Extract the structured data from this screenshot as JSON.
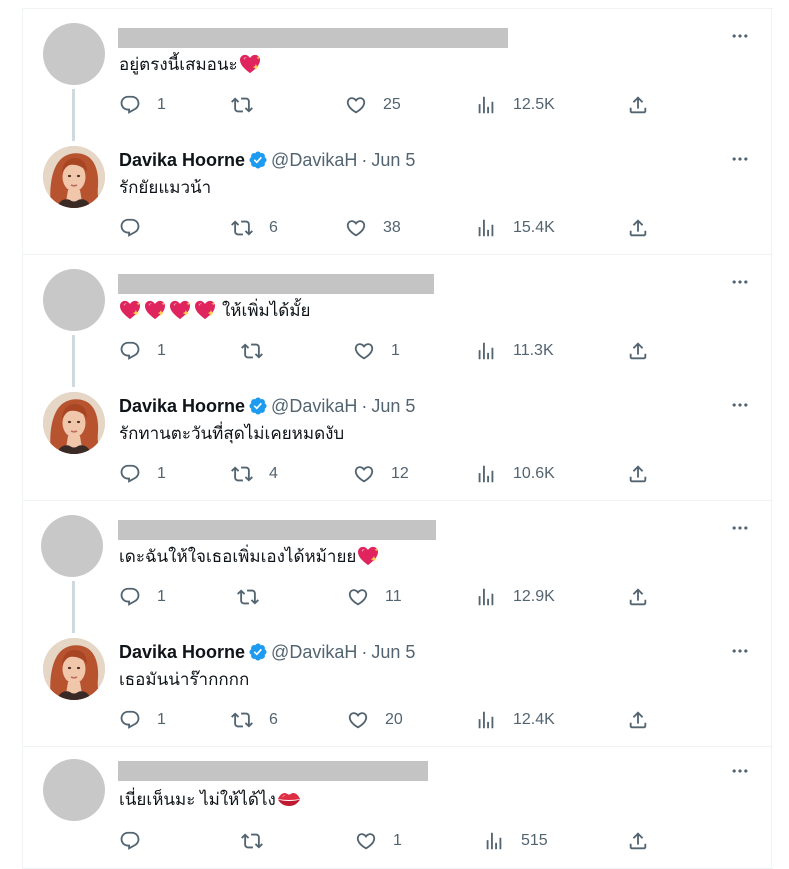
{
  "colors": {
    "accent": "#1d9bf0",
    "icon": "#536471",
    "redaction": "#c4c4c4",
    "heart_emoji": "#e0245e",
    "sparkle": "#ffd34d",
    "kiss": "#dd2e44"
  },
  "groups": [
    {
      "reply": {
        "text": "อยู่ตรงนี้เสมอนะ",
        "emoji": "sparkling-heart-emoji",
        "replies": "1",
        "reposts": "",
        "likes": "25",
        "views": "12.5K"
      },
      "author": {
        "name": "Davika Hoorne",
        "handle": "@DavikaH",
        "separator": "·",
        "date": "Jun 5",
        "text": "รักยัยแมวน้า",
        "replies": "",
        "reposts": "6",
        "likes": "38",
        "views": "15.4K"
      }
    },
    {
      "reply": {
        "text": "ให้เพิ่มได้มั้ย",
        "emoji": "sparkling-heart-emoji x4",
        "replies": "1",
        "reposts": "",
        "likes": "1",
        "views": "11.3K"
      },
      "author": {
        "name": "Davika Hoorne",
        "handle": "@DavikaH",
        "separator": "·",
        "date": "Jun 5",
        "text": "รักทานตะวันที่สุดไม่เคยหมดงับ",
        "replies": "1",
        "reposts": "4",
        "likes": "12",
        "views": "10.6K"
      }
    },
    {
      "reply": {
        "text": "เดะฉันให้ใจเธอเพิ่มเองได้หม้ายย",
        "emoji": "sparkling-heart-emoji",
        "replies": "1",
        "reposts": "",
        "likes": "11",
        "views": "12.9K"
      },
      "author": {
        "name": "Davika Hoorne",
        "handle": "@DavikaH",
        "separator": "·",
        "date": "Jun 5",
        "text": "เธอมันน่าร๊ากกกก",
        "replies": "1",
        "reposts": "6",
        "likes": "20",
        "views": "12.4K"
      }
    },
    {
      "reply": {
        "text": "เนี่ยเห็นมะ ไม่ให้ได้ไง",
        "emoji": "kiss-mark-emoji",
        "replies": "",
        "reposts": "",
        "likes": "1",
        "views": "515"
      }
    }
  ]
}
